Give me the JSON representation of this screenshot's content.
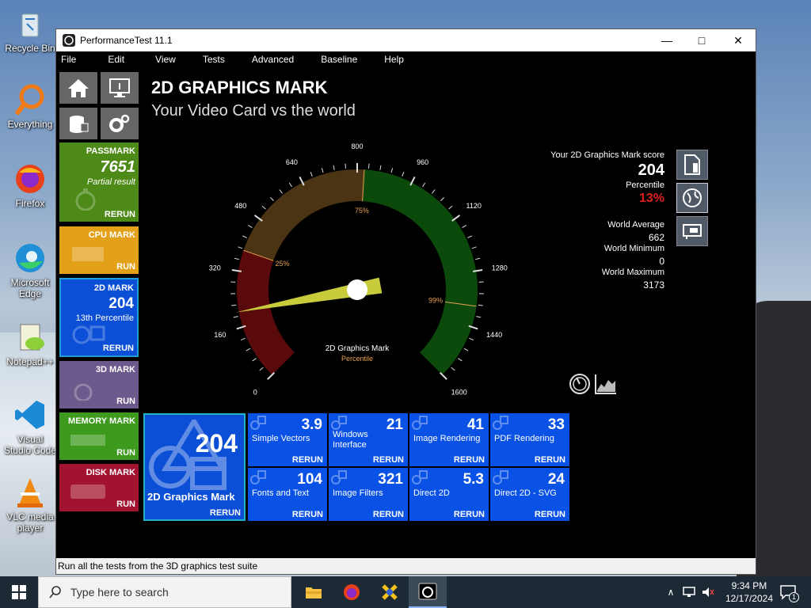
{
  "desktop": {
    "icons": [
      {
        "label": "Recycle Bin"
      },
      {
        "label": "Everything"
      },
      {
        "label": "Firefox"
      },
      {
        "label": "Microsoft Edge"
      },
      {
        "label": "Notepad++"
      },
      {
        "label": "Visual Studio Code"
      },
      {
        "label": "VLC media player"
      }
    ]
  },
  "window": {
    "title": "PerformanceTest 11.1",
    "menu": [
      "File",
      "Edit",
      "View",
      "Tests",
      "Advanced",
      "Baseline",
      "Help"
    ]
  },
  "sidebar": {
    "tiles": [
      {
        "title": "PASSMARK",
        "score": "7651",
        "sub": "Partial result",
        "action": "RERUN",
        "color": "#4e8a18"
      },
      {
        "title": "CPU MARK",
        "action": "RUN",
        "color": "#e3a019"
      },
      {
        "title": "2D MARK",
        "score": "204",
        "sub": "13th Percentile",
        "action": "RERUN",
        "color": "#0b4fd6"
      },
      {
        "title": "3D MARK",
        "action": "RUN",
        "color": "#6d5a8c"
      },
      {
        "title": "MEMORY MARK",
        "action": "RUN",
        "color": "#3d9a1c"
      },
      {
        "title": "DISK MARK",
        "action": "RUN",
        "color": "#a3122f"
      }
    ]
  },
  "header": {
    "title": "2D GRAPHICS MARK",
    "subtitle": "Your Video Card vs the world"
  },
  "gauge": {
    "min": 0,
    "max": 1600,
    "ticks": [
      "0",
      "160",
      "320",
      "480",
      "640",
      "800",
      "960",
      "1120",
      "1280",
      "1440",
      "1600"
    ],
    "needle_value": 204,
    "percentile_markers": [
      {
        "label": "25%",
        "value": 380
      },
      {
        "label": "75%",
        "value": 820
      },
      {
        "label": "99%",
        "value": 1380
      }
    ],
    "center_label": "2D Graphics Mark",
    "center_sub": "Percentile",
    "colors": {
      "low": "#5a0a0a",
      "mid": "#4a3414",
      "high": "#0b4a0b",
      "needle": "#c8cc3a"
    }
  },
  "stats": {
    "score_label": "Your 2D Graphics Mark score",
    "score": "204",
    "percentile_label": "Percentile",
    "percentile": "13%",
    "world_average_label": "World Average",
    "world_average": "662",
    "world_min_label": "World Minimum",
    "world_min": "0",
    "world_max_label": "World Maximum",
    "world_max": "3173",
    "accent_red": "#e0201c"
  },
  "main_tile": {
    "value": "204",
    "label": "2D Graphics Mark",
    "action": "RERUN"
  },
  "subtests": [
    {
      "value": "3.9",
      "name": "Simple Vectors",
      "action": "RERUN"
    },
    {
      "value": "21",
      "name": "Windows Interface",
      "action": "RERUN"
    },
    {
      "value": "41",
      "name": "Image Rendering",
      "action": "RERUN"
    },
    {
      "value": "33",
      "name": "PDF Rendering",
      "action": "RERUN"
    },
    {
      "value": "104",
      "name": "Fonts and Text",
      "action": "RERUN"
    },
    {
      "value": "321",
      "name": "Image Filters",
      "action": "RERUN"
    },
    {
      "value": "5.3",
      "name": "Direct 2D",
      "action": "RERUN"
    },
    {
      "value": "24",
      "name": "Direct 2D - SVG",
      "action": "RERUN"
    }
  ],
  "statusbar": {
    "text": "Run all the tests from the 3D graphics test suite"
  },
  "taskbar": {
    "search_placeholder": "Type here to search",
    "time": "9:34 PM",
    "date": "12/17/2024",
    "notification_count": "1"
  }
}
